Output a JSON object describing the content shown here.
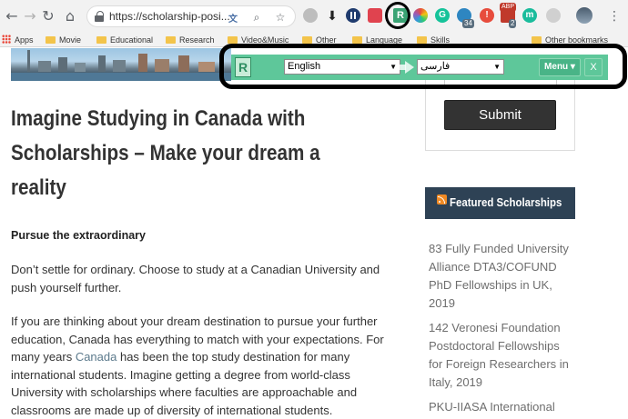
{
  "browser": {
    "url": "https://scholarship-posi...",
    "extensions": [
      {
        "name": "translate-icon",
        "color": "#4a6fa5"
      },
      {
        "name": "zoom-icon",
        "color": "#5f6368"
      },
      {
        "name": "star-icon",
        "color": "#5f6368"
      },
      {
        "name": "globe-icon",
        "color": "#9e9e9e"
      },
      {
        "name": "download-icon",
        "color": "#222222"
      },
      {
        "name": "pause-icon",
        "color": "#1f3b6e"
      },
      {
        "name": "pocket-icon",
        "color": "#e0434f"
      },
      {
        "name": "mail-icon",
        "color": "#d93025"
      },
      {
        "name": "readlang-icon",
        "color": "#3aa374"
      },
      {
        "name": "color-icon",
        "color": "#9b59b6"
      },
      {
        "name": "grammarly-icon",
        "color": "#15c39a"
      },
      {
        "name": "counter-icon",
        "color": "#2e86c1"
      },
      {
        "name": "alert-icon",
        "color": "#e74c3c"
      },
      {
        "name": "adblock-icon",
        "color": "#c0392b"
      },
      {
        "name": "mendeley-icon",
        "color": "#1abc9c"
      },
      {
        "name": "more-icon",
        "color": "#5f6368"
      }
    ],
    "badges": {
      "counter": "34",
      "adblock": "2",
      "adblock_top": "ABP"
    }
  },
  "bookmarks": {
    "apps": "Apps",
    "items": [
      "Movie",
      "Educational",
      "Research",
      "Video&Music",
      "Other",
      "Language",
      "Skills"
    ],
    "other": "Other bookmarks"
  },
  "translator": {
    "logo": "R",
    "source_lang": "English",
    "target_lang": "فارسی",
    "menu": "Menu ▾",
    "close": "X"
  },
  "article": {
    "title_lines": [
      "Imagine Studying in Canada with",
      "Scholarships – Make your dream a",
      "reality"
    ],
    "subheading": "Pursue the extraordinary",
    "para1": [
      "Don’t settle for ordinary. Choose to study at a Canadian University and",
      "push yourself further."
    ],
    "para2_l1": "If you are thinking about your dream destination to pursue your further",
    "para2_l2": "education, Canada has everything to match with your expectations. For",
    "para2_l3_pre": "many years ",
    "para2_l3_link": "Canada",
    "para2_l3_post": " has been the top study destination for many",
    "para2_l4": "international students. Imagine getting a degree from world-class",
    "para2_l5": "University with scholarships where faculties are approachable and",
    "para2_l6": "classrooms are made up of diversity of international students."
  },
  "sidebar": {
    "submit": "Submit",
    "featured_title": "Featured Scholarships",
    "scholarships": [
      [
        "83 Fully Funded University",
        "Alliance DTA3/COFUND",
        "PhD Fellowships in UK,",
        "2019"
      ],
      [
        "142 Veronesi Foundation",
        "Postdoctoral Fellowships",
        "for Foreign Researchers in",
        "Italy, 2019"
      ],
      [
        "PKU-IIASA International"
      ]
    ]
  }
}
